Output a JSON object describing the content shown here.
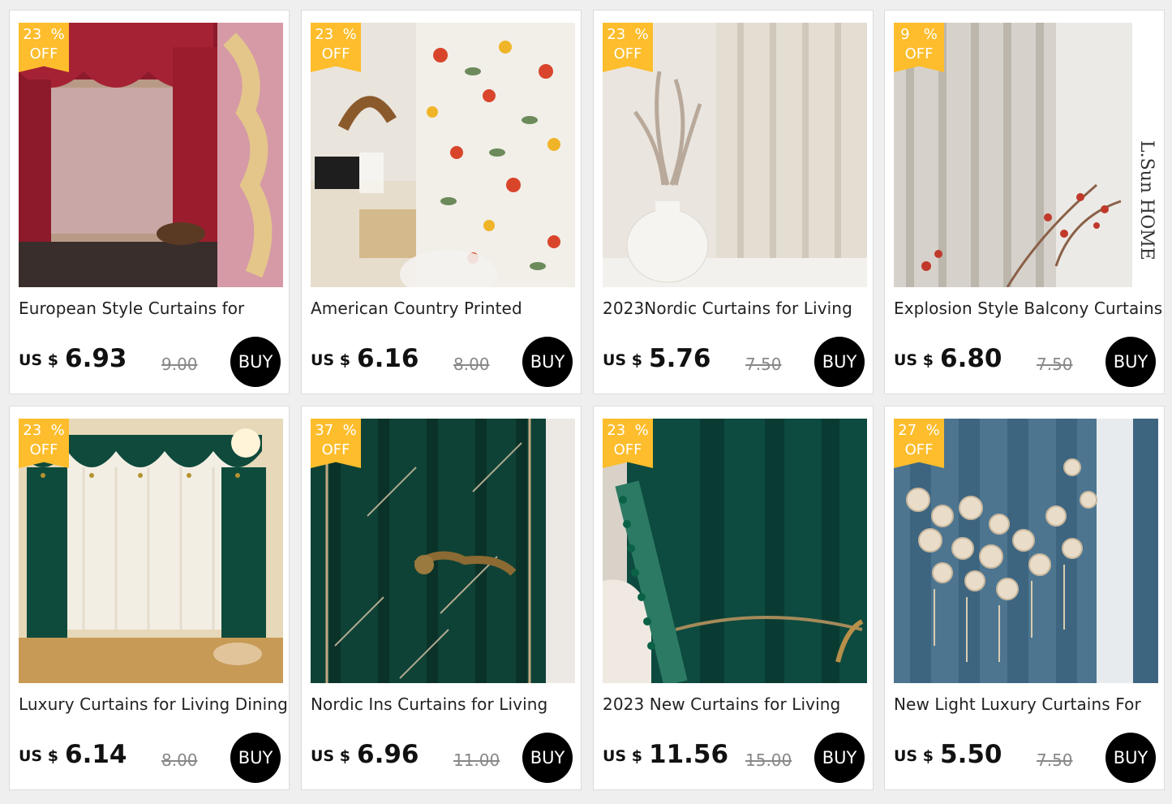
{
  "products": [
    {
      "title": "European Style Curtains for",
      "currency": "US $",
      "price": "6.93",
      "old_price": "9.00",
      "discount": "23  %",
      "off": "OFF",
      "buy": "BUY"
    },
    {
      "title": "American Country Printed",
      "currency": "US $",
      "price": "6.16",
      "old_price": "8.00",
      "discount": "23  %",
      "off": "OFF",
      "buy": "BUY"
    },
    {
      "title": "2023Nordic Curtains for Living",
      "currency": "US $",
      "price": "5.76",
      "old_price": "7.50",
      "discount": "23  %",
      "off": "OFF",
      "buy": "BUY"
    },
    {
      "title": "Explosion Style Balcony Curtains",
      "currency": "US $",
      "price": "6.80",
      "old_price": "7.50",
      "discount": "9   %",
      "off": "OFF",
      "buy": "BUY",
      "image_text": "L.Sun HOME"
    },
    {
      "title": "Luxury Curtains for Living Dining",
      "currency": "US $",
      "price": "6.14",
      "old_price": "8.00",
      "discount": "23  %",
      "off": "OFF",
      "buy": "BUY"
    },
    {
      "title": "Nordic Ins Curtains for Living",
      "currency": "US $",
      "price": "6.96",
      "old_price": "11.00",
      "discount": "37  %",
      "off": "OFF",
      "buy": "BUY"
    },
    {
      "title": "2023 New Curtains for Living",
      "currency": "US $",
      "price": "11.56",
      "old_price": "15.00",
      "discount": "23  %",
      "off": "OFF",
      "buy": "BUY"
    },
    {
      "title": "New Light Luxury Curtains For",
      "currency": "US $",
      "price": "5.50",
      "old_price": "7.50",
      "discount": "27  %",
      "off": "OFF",
      "buy": "BUY"
    }
  ],
  "colors": {
    "badge": "#fdbd2c",
    "buy": "#000000",
    "background": "#efefef"
  }
}
